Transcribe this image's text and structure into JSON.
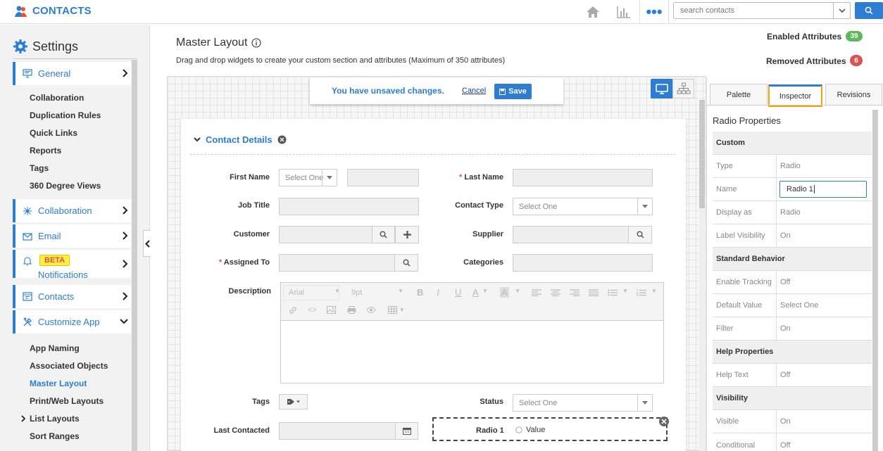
{
  "app": {
    "title": "CONTACTS"
  },
  "topbar": {
    "search_placeholder": "search contacts",
    "more_icon": "•••"
  },
  "sidebar": {
    "title": "Settings",
    "sections": [
      {
        "label": "General",
        "icon": "monitor-icon"
      },
      {
        "label": "Collaboration",
        "icon": "collaboration-icon"
      },
      {
        "label": "Email",
        "icon": "envelope-icon"
      },
      {
        "label": "Notifications",
        "icon": "bell-icon",
        "badge": "BETA"
      },
      {
        "label": "Contacts",
        "icon": "contacts-icon"
      },
      {
        "label": "Customize App",
        "icon": "tools-icon"
      }
    ],
    "general_items": [
      "Collaboration",
      "Duplication Rules",
      "Quick Links",
      "Reports",
      "Tags",
      "360 Degree Views"
    ],
    "customize_items": [
      "App Naming",
      "Associated Objects",
      "Master Layout",
      "Print/Web Layouts",
      "List Layouts",
      "Sort Ranges"
    ]
  },
  "header": {
    "title": "Master Layout",
    "description": "Drag and drop widgets to create your custom section and attributes (Maximum of 350 attributes)",
    "enabled_label": "Enabled Attributes",
    "enabled_count": "39",
    "removed_label": "Removed Attributes",
    "removed_count": "6"
  },
  "unsaved": {
    "message": "You have unsaved changes.",
    "cancel": "Cancel",
    "save": "Save"
  },
  "section": {
    "title": "Contact Details",
    "fields": {
      "first_name": "First Name",
      "first_name_select": "Select One",
      "last_name": "Last Name",
      "job_title": "Job Title",
      "contact_type": "Contact Type",
      "contact_type_select": "Select One",
      "customer": "Customer",
      "supplier": "Supplier",
      "assigned_to": "Assigned To",
      "categories": "Categories",
      "description": "Description",
      "tags": "Tags",
      "status": "Status",
      "status_select": "Select One",
      "last_contacted": "Last Contacted",
      "radio_label": "Radio 1",
      "radio_value": "Value"
    },
    "editor": {
      "font": "Arial",
      "size": "9pt"
    }
  },
  "panel": {
    "tabs": [
      "Palette",
      "Inspector",
      "Revisions"
    ],
    "title": "Radio Properties",
    "groups": {
      "custom": "Custom",
      "standard": "Standard Behavior",
      "help": "Help Properties",
      "visibility": "Visibility"
    },
    "rows": {
      "type": [
        "Type",
        "Radio"
      ],
      "name": [
        "Name",
        "Radio 1"
      ],
      "display": [
        "Display as",
        "Radio"
      ],
      "label_vis": [
        "Label Visibility",
        "On"
      ],
      "tracking": [
        "Enable Tracking",
        "Off"
      ],
      "default": [
        "Default Value",
        "Select One"
      ],
      "filter": [
        "Filter",
        "On"
      ],
      "help_text": [
        "Help Text",
        "Off"
      ],
      "visible": [
        "Visible",
        "On"
      ],
      "conditional": [
        "Conditional",
        "Off"
      ]
    }
  },
  "colors": {
    "accent": "#2d7dd2",
    "green": "#5cb85c",
    "red": "#d9534f",
    "tab_highlight": "#f0a30a"
  }
}
